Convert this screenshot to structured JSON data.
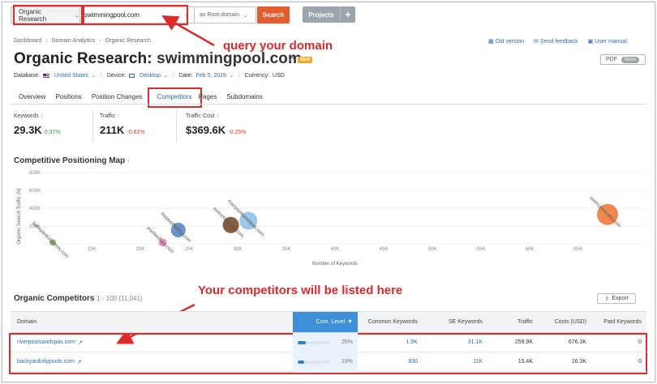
{
  "search_bar": {
    "database_select": "Organic Research",
    "query": "swimmingpool.com",
    "scope": "as Root domain",
    "search_button": "Search",
    "projects_button": "Projects"
  },
  "annotations": {
    "query_callout": "query your domain",
    "competitors_callout": "Your competitors will be listed here"
  },
  "breadcrumb": [
    "Dashboard",
    "Domain Analytics",
    "Organic Research"
  ],
  "header_links": [
    "Old version",
    "Send feedback",
    "User manual"
  ],
  "page": {
    "title": "Organic Research:",
    "domain": "swimmingpool.com",
    "new_badge": "NEW",
    "pdf_label": "PDF",
    "pdf_soon": "Soon"
  },
  "filters": {
    "database_label": "Database:",
    "database_value": "United States",
    "device_label": "Device:",
    "device_value": "Desktop",
    "date_label": "Date:",
    "date_value": "Feb 5, 2019",
    "currency_label": "Currency:",
    "currency_value": "USD"
  },
  "tabs": [
    "Overview",
    "Positions",
    "Position Changes",
    "Competitors",
    "Pages",
    "Subdomains"
  ],
  "active_tab": "Competitors",
  "metrics": [
    {
      "label": "Keywords",
      "value": "29.3K",
      "delta": "0.37%",
      "trend": "up"
    },
    {
      "label": "Traffic",
      "value": "211K",
      "delta": "-0.62%",
      "trend": "down"
    },
    {
      "label": "Traffic Cost",
      "value": "$369.6K",
      "delta": "-0.25%",
      "trend": "down"
    }
  ],
  "chart_section_title": "Competitive Positioning Map",
  "chart_data": {
    "type": "scatter",
    "title": "Competitive Positioning Map",
    "xlabel": "Number of Keywords",
    "ylabel": "Organic Search Traffic (N)",
    "x_ticks": [
      "15K",
      "20K",
      "25K",
      "30K",
      "35K",
      "40K",
      "45K",
      "50K",
      "55K",
      "60K",
      "65K"
    ],
    "y_ticks": [
      "200K",
      "400K",
      "600K",
      "800K"
    ],
    "xlim": [
      10000,
      70000
    ],
    "ylim": [
      0,
      800000
    ],
    "grid": true,
    "points": [
      {
        "label": "backyardcitypools.com",
        "x": 11000,
        "y": 16300,
        "r": 4,
        "color": "#7ab65a"
      },
      {
        "label": "poolandspa.com",
        "x": 22300,
        "y": 15000,
        "r": 5,
        "color": "#e887b4"
      },
      {
        "label": "thepoolfactory.com",
        "x": 23900,
        "y": 155000,
        "r": 9,
        "color": "#5a87c5"
      },
      {
        "label": "swimmingpool.com",
        "x": 29300,
        "y": 211000,
        "r": 10,
        "color": "#7a4a2a"
      },
      {
        "label": "riverpoolsandspas.com",
        "x": 31100,
        "y": 259900,
        "r": 11,
        "color": "#8fc1e8"
      },
      {
        "label": "swimuniversity.com",
        "x": 68000,
        "y": 330000,
        "r": 13,
        "color": "#f07b3a"
      }
    ]
  },
  "competitors": {
    "title": "Organic Competitors",
    "count": "1 - 100 (11,041)",
    "export_label": "Export",
    "columns": [
      "Domain",
      "Com. Level",
      "Common Keywords",
      "SE Keywords",
      "Traffic",
      "Costs (USD)",
      "Paid Keywords"
    ],
    "rows": [
      {
        "domain": "riverpoolsandspas.com",
        "com_level": "26%",
        "com_level_value": 0.26,
        "common_keywords": "1.9K",
        "se_keywords": "31.1K",
        "traffic": "259.9K",
        "costs": "676.3K",
        "paid_keywords": "0"
      },
      {
        "domain": "backyardcitypools.com",
        "com_level": "19%",
        "com_level_value": 0.19,
        "common_keywords": "830",
        "se_keywords": "11K",
        "traffic": "15.4K",
        "costs": "16.3K",
        "paid_keywords": "0"
      }
    ]
  }
}
